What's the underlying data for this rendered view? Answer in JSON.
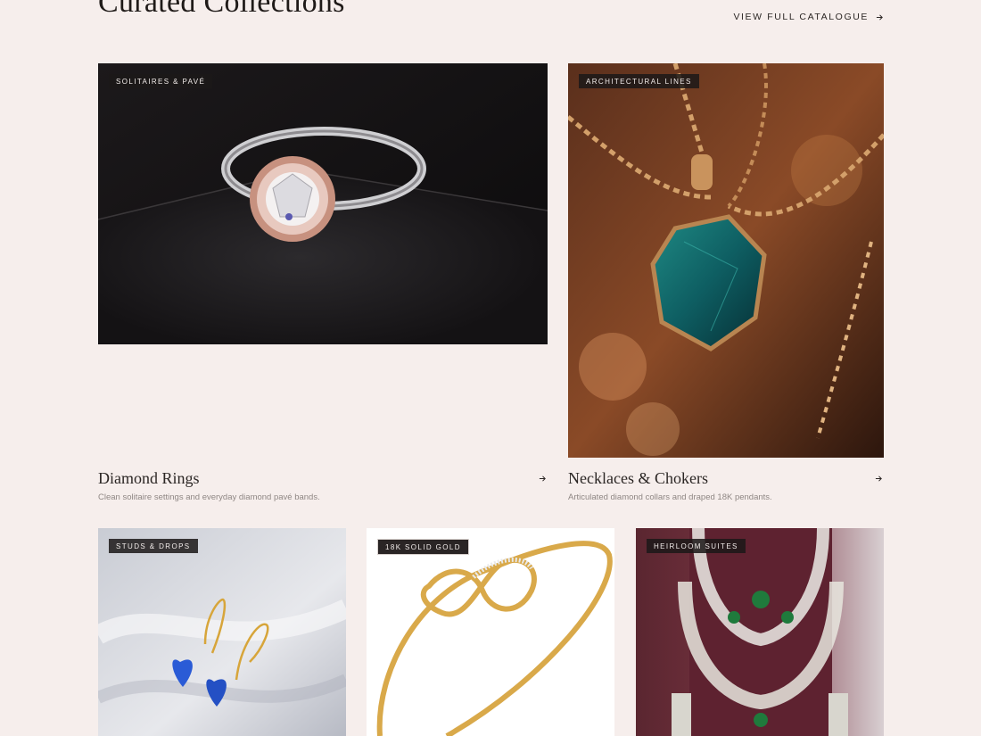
{
  "header": {
    "title": "Curated Collections",
    "view_all": "VIEW FULL CATALOGUE"
  },
  "collections": [
    {
      "badge": "SOLITAIRES & PAVÉ",
      "title": "Diamond Rings",
      "description": "Clean solitaire settings and everyday diamond pavé bands."
    },
    {
      "badge": "ARCHITECTURAL LINES",
      "title": "Necklaces & Chokers",
      "description": "Articulated diamond collars and draped 18K pendants."
    },
    {
      "badge": "STUDS & DROPS"
    },
    {
      "badge": "18K SOLID GOLD"
    },
    {
      "badge": "HEIRLOOM SUITES"
    }
  ],
  "colors": {
    "background": "#f6eeec",
    "text": "#2b2624",
    "muted": "#8f8784",
    "badge_bg": "#1c1818"
  },
  "icons": [
    "arrow-right-icon"
  ]
}
